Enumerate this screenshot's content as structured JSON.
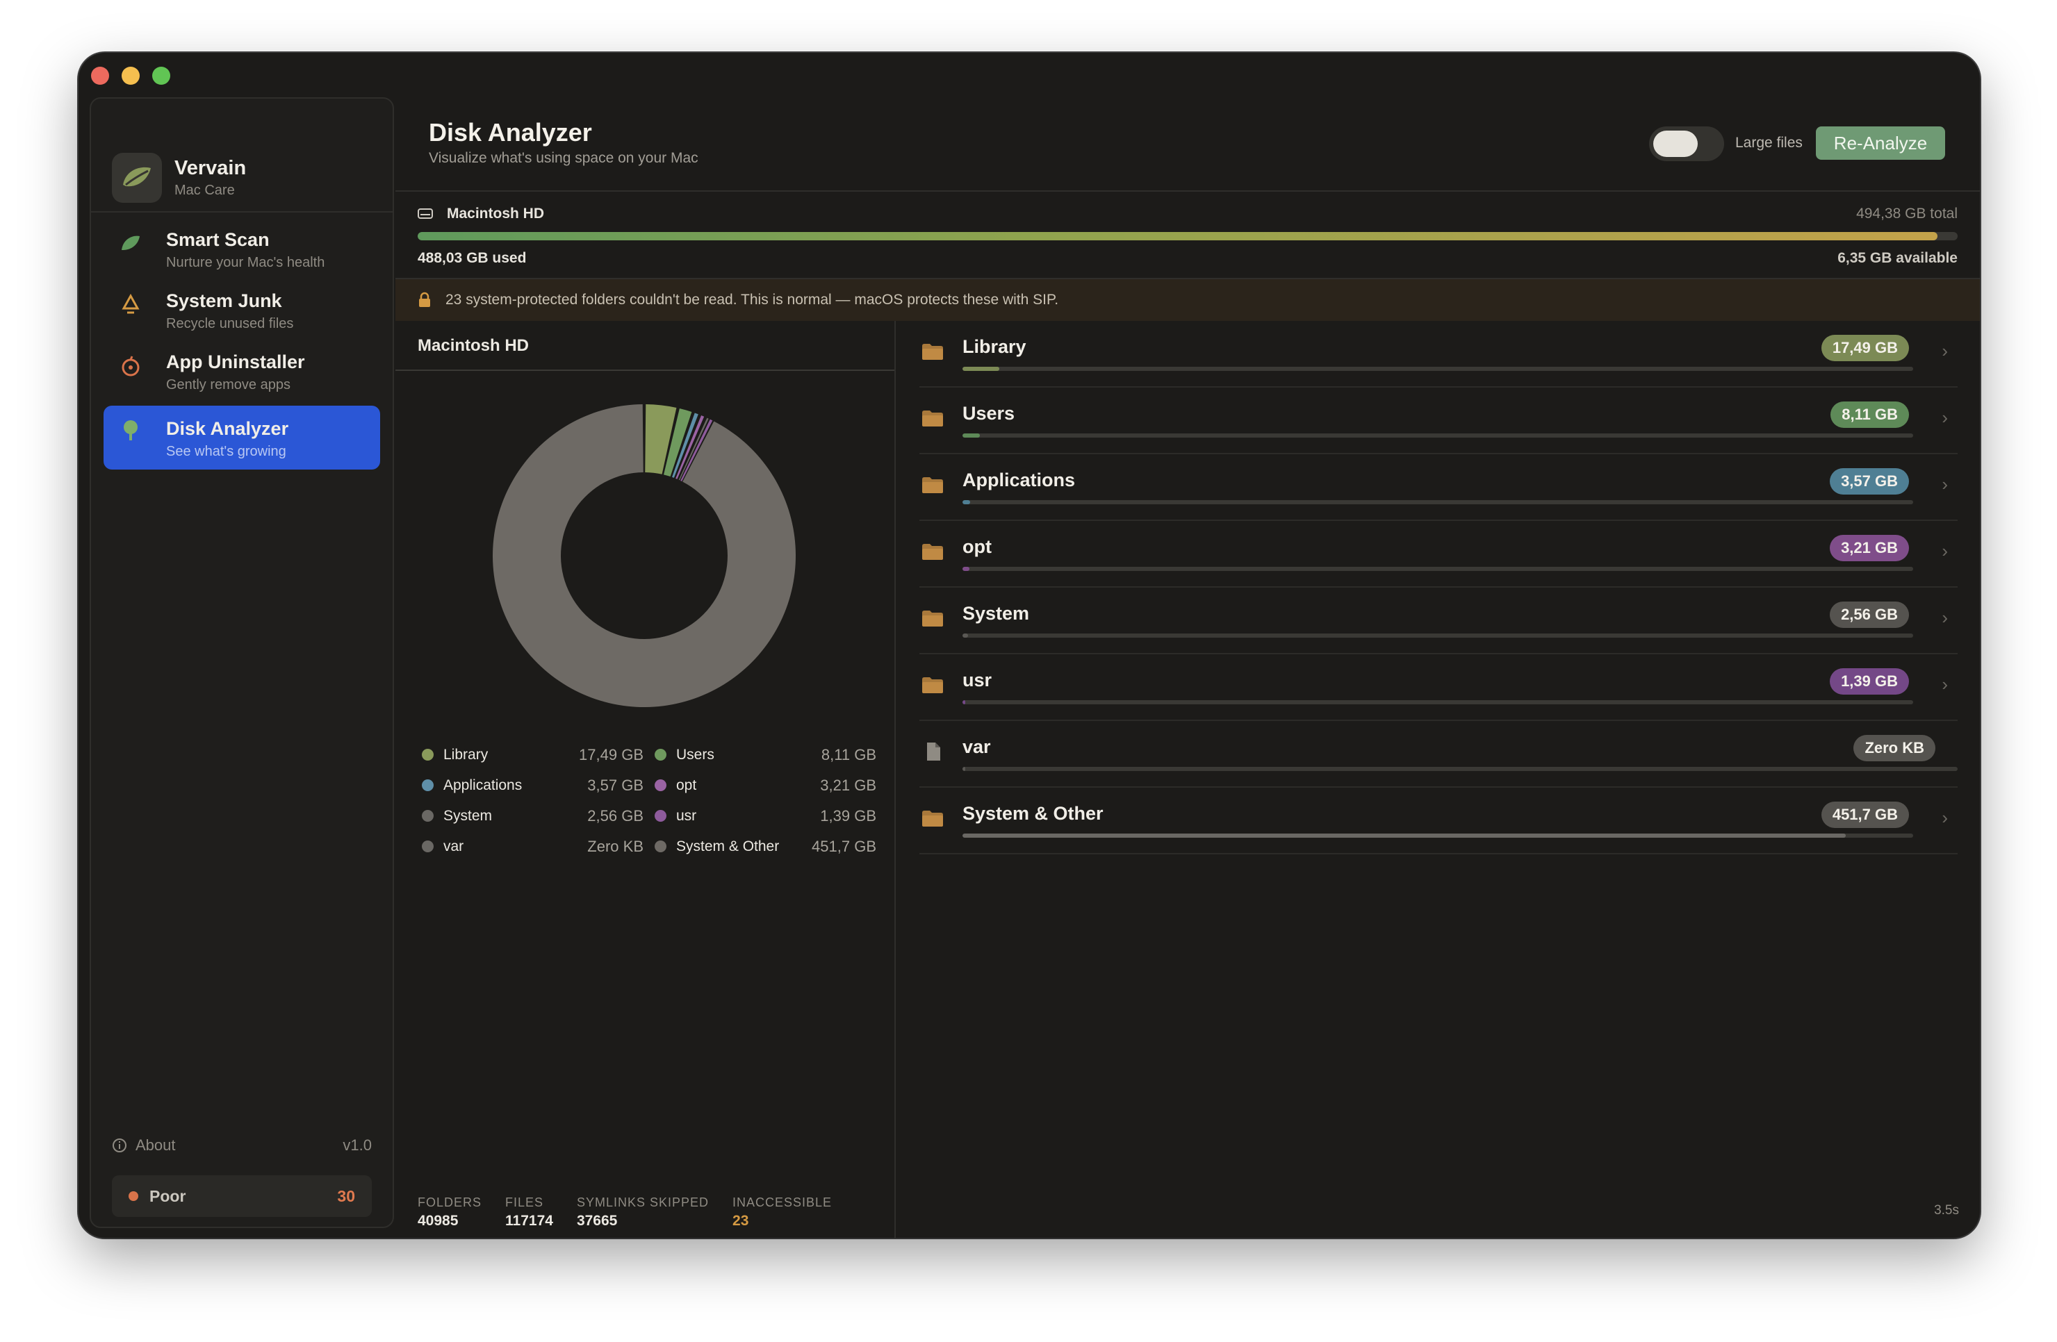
{
  "brand": {
    "title": "Vervain",
    "subtitle": "Mac Care"
  },
  "sidebar": {
    "items": [
      {
        "label": "Smart Scan",
        "sub": "Nurture your Mac's health",
        "icon": "leaf-icon"
      },
      {
        "label": "System Junk",
        "sub": "Recycle unused files",
        "icon": "recycle-icon"
      },
      {
        "label": "App Uninstaller",
        "sub": "Gently remove apps",
        "icon": "apple-icon"
      },
      {
        "label": "Disk Analyzer",
        "sub": "See what's growing",
        "icon": "tree-icon",
        "active": true
      }
    ],
    "about": "About",
    "version": "v1.0",
    "health_label": "Poor",
    "health_score": "30"
  },
  "header": {
    "title": "Disk Analyzer",
    "subtitle": "Visualize what's using space on your Mac",
    "toggle_label": "Large files",
    "reanalyze": "Re-Analyze"
  },
  "disk": {
    "name": "Macintosh HD",
    "total": "494,38 GB total",
    "used": "488,03 GB used",
    "available": "6,35 GB available",
    "used_fraction": 0.987
  },
  "warning": "23 system-protected folders couldn't be read. This is normal — macOS protects these with SIP.",
  "pane_title": "Macintosh HD",
  "chart_data": {
    "type": "pie",
    "title": "",
    "categories": [
      "Library",
      "Users",
      "Applications",
      "opt",
      "System",
      "usr",
      "var",
      "System & Other"
    ],
    "values": [
      17.49,
      8.11,
      3.57,
      3.21,
      2.56,
      1.39,
      0,
      451.7
    ],
    "value_labels": [
      "17,49 GB",
      "8,11 GB",
      "3,57 GB",
      "3,21 GB",
      "2,56 GB",
      "1,39 GB",
      "Zero KB",
      "451,7 GB"
    ],
    "colors": [
      "#8a9a5b",
      "#6f9a5e",
      "#5f8fa8",
      "#9a63a3",
      "#6a6864",
      "#8e5b9c",
      "#6a6864",
      "#6e6a65"
    ],
    "unit": "GB",
    "donut": true
  },
  "folders": [
    {
      "name": "Library",
      "size": "17,49 GB",
      "fraction": 0.0387,
      "color": "#7c8a55",
      "bar": "#7c8a55",
      "icon": "folder-icon",
      "chevron": true
    },
    {
      "name": "Users",
      "size": "8,11 GB",
      "fraction": 0.018,
      "color": "#5e8a58",
      "bar": "#5e8a58",
      "icon": "folder-icon",
      "chevron": true
    },
    {
      "name": "Applications",
      "size": "3,57 GB",
      "fraction": 0.0079,
      "color": "#4f7f94",
      "bar": "#4f7f94",
      "icon": "folder-icon",
      "chevron": true
    },
    {
      "name": "opt",
      "size": "3,21 GB",
      "fraction": 0.0071,
      "color": "#7f4d8a",
      "bar": "#7f4d8a",
      "icon": "folder-icon",
      "chevron": true
    },
    {
      "name": "System",
      "size": "2,56 GB",
      "fraction": 0.0057,
      "color": "#55534f",
      "bar": "#5a5854",
      "icon": "folder-icon",
      "chevron": true
    },
    {
      "name": "usr",
      "size": "1,39 GB",
      "fraction": 0.0031,
      "color": "#744887",
      "bar": "#744887",
      "icon": "folder-icon",
      "chevron": true
    },
    {
      "name": "var",
      "size": "Zero KB",
      "fraction": 0.003,
      "color": "#55534f",
      "bar": "#5a5854",
      "icon": "file-icon",
      "chevron": false
    },
    {
      "name": "System & Other",
      "size": "451,7 GB",
      "fraction": 0.929,
      "color": "#55534f",
      "bar": "#6a6864",
      "icon": "folder-icon",
      "chevron": true
    }
  ],
  "stats": [
    {
      "label": "FOLDERS",
      "value": "40985"
    },
    {
      "label": "FILES",
      "value": "117174"
    },
    {
      "label": "SYMLINKS SKIPPED",
      "value": "37665"
    },
    {
      "label": "INACCESSIBLE",
      "value": "23"
    }
  ],
  "elapsed": "3.5s"
}
